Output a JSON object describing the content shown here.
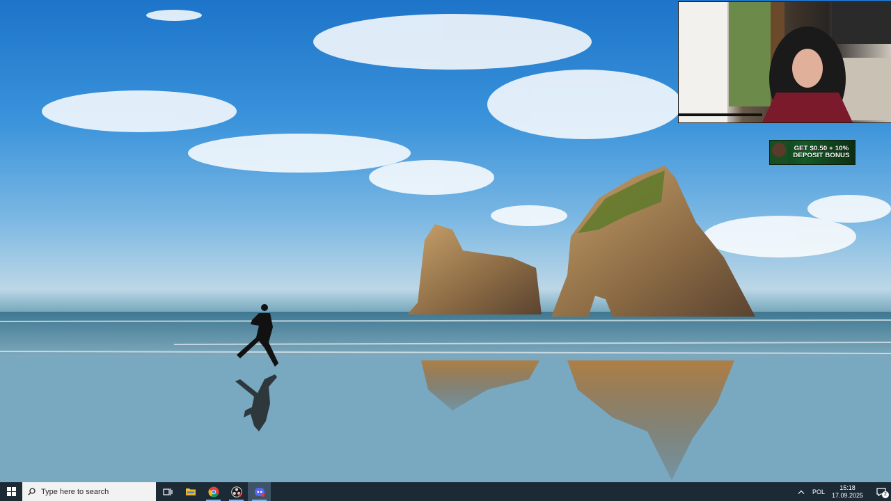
{
  "promo_banner": {
    "line1": "GET $0.50 + 10%",
    "line2": "DEPOSIT BONUS"
  },
  "taskbar": {
    "search_placeholder": "Type here to search",
    "apps": [
      {
        "name": "task-view",
        "icon": "task-view-icon"
      },
      {
        "name": "file-explorer",
        "icon": "folder-icon"
      },
      {
        "name": "chrome",
        "icon": "chrome-icon"
      },
      {
        "name": "obs-studio",
        "icon": "obs-icon"
      },
      {
        "name": "discord",
        "icon": "discord-icon"
      }
    ],
    "tray": {
      "language": "POL",
      "time": "15:18",
      "date": "17.09.2025",
      "notification_count": "2"
    }
  },
  "colors": {
    "taskbar_bg": "#1c2a36",
    "search_bg": "#f2f2f2",
    "running_indicator": "#7fb2e6"
  }
}
